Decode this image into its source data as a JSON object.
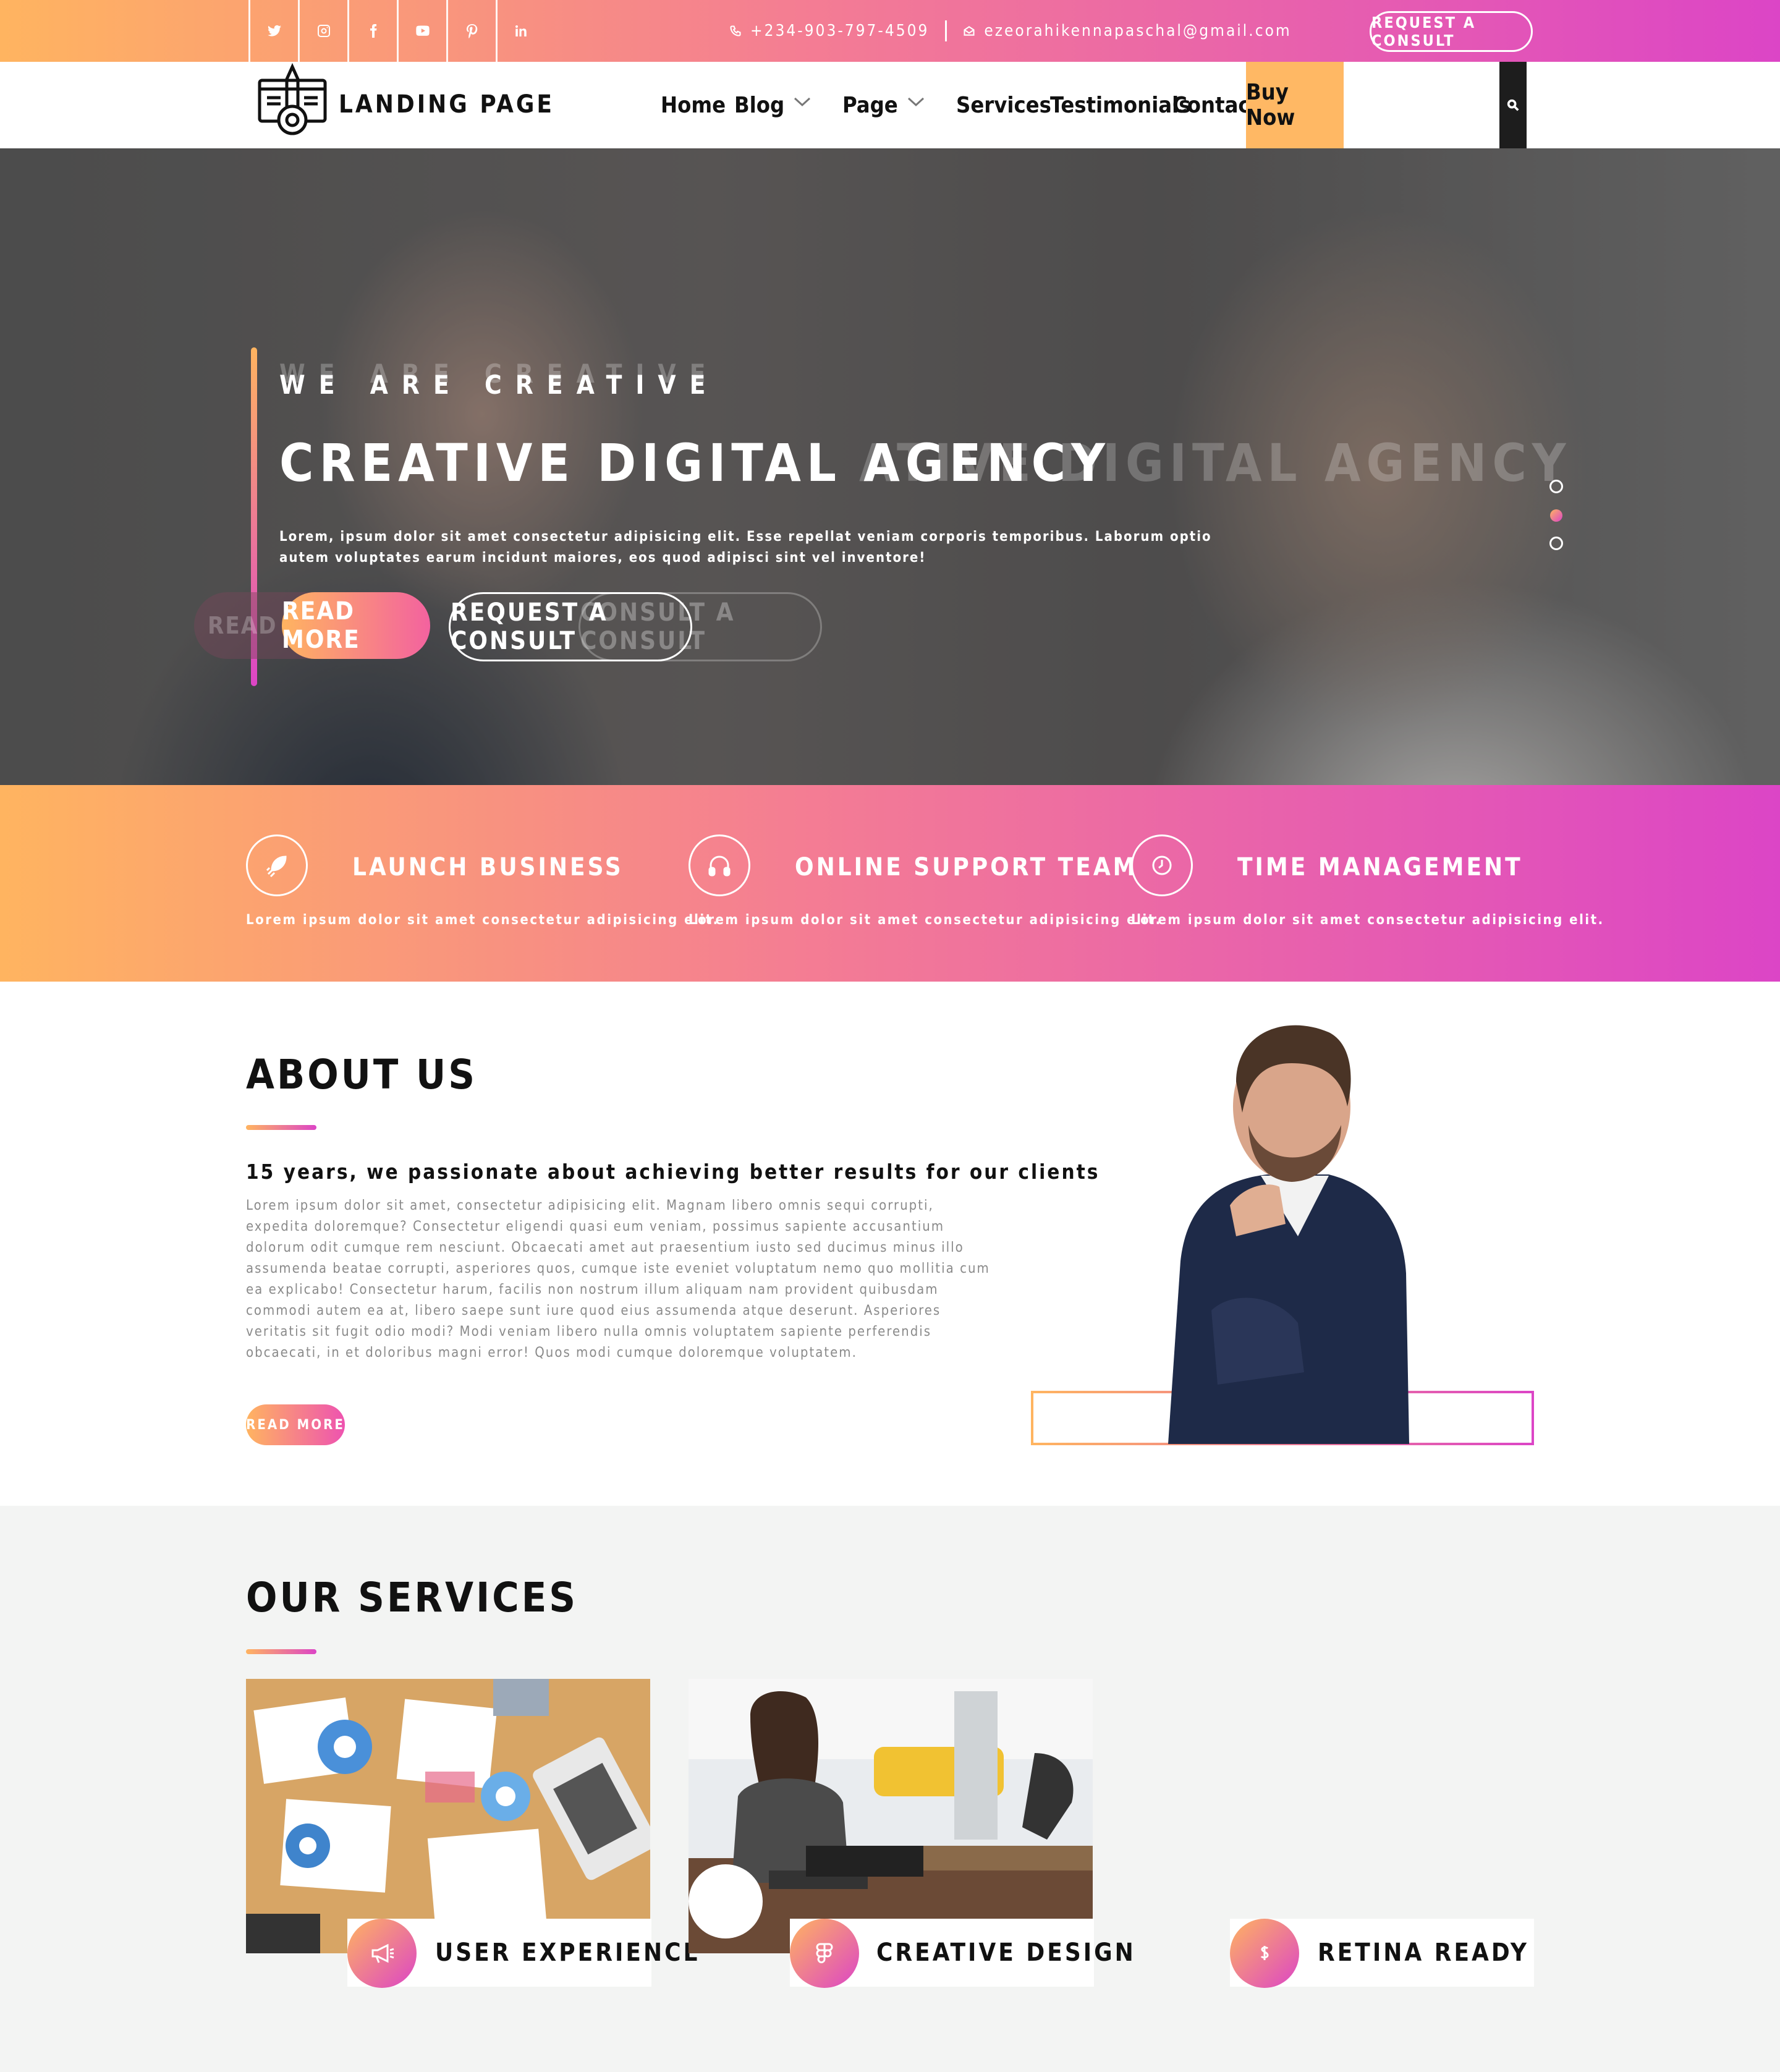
{
  "topbar": {
    "socials": [
      "twitter-icon",
      "instagram-icon",
      "facebook-icon",
      "youtube-icon",
      "pinterest-icon",
      "linkedin-icon"
    ],
    "phone": "+234-903-797-4509",
    "email": "ezeorahikennapaschal@gmail.com",
    "consult_label": "REQUEST A CONSULT"
  },
  "nav": {
    "logo_text": "LANDING PAGE",
    "items": [
      "Home",
      "Blog",
      "Page",
      "Services",
      "Testimonials",
      "Contact"
    ],
    "buy_label": "Buy Now"
  },
  "hero": {
    "subtitle": "WE ARE CREATIVE",
    "title": "CREATIVE DIGITAL AGENCY",
    "title_ghost": "ATIVE DIGITAL AGENCY",
    "text": "Lorem, ipsum dolor sit amet consectetur adipisicing elit. Esse repellat veniam corporis temporibus. Laborum optio autem voluptates earum incidunt maiores, eos quod adipisci sint vel inventore!",
    "read_more": "READ MORE",
    "read_more_ghost": "READ M",
    "consult": "REQUEST A CONSULT",
    "consult_ghost": "CONSULT A CONSULT",
    "slides": 3,
    "active_slide": 2
  },
  "features": [
    {
      "icon": "rocket-icon",
      "title": "LAUNCH BUSINESS",
      "text": "Lorem ipsum dolor sit amet consectetur adipisicing elit."
    },
    {
      "icon": "headphones-icon",
      "title": "ONLINE SUPPORT TEAM",
      "text": "Lorem ipsum dolor sit amet consectetur adipisicing elit."
    },
    {
      "icon": "clock-icon",
      "title": "TIME MANAGEMENT",
      "text": "Lorem ipsum dolor sit amet consectetur adipisicing elit."
    }
  ],
  "about": {
    "title": "ABOUT US",
    "subtitle": "15 years, we passionate about achieving better results for our clients",
    "text": "Lorem ipsum dolor sit amet, consectetur adipisicing elit. Magnam libero omnis sequi corrupti, expedita doloremque? Consectetur eligendi quasi eum veniam, possimus sapiente accusantium dolorum odit cumque rem nesciunt. Obcaecati amet aut praesentium iusto sed ducimus minus illo assumenda beatae corrupti, asperiores quos, cumque iste eveniet voluptatum nemo quo mollitia cum ea explicabo! Consectetur harum, facilis non nostrum illum aliquam nam provident quibusdam commodi autem ea at, libero saepe sunt iure quod eius assumenda atque deserunt. Asperiores veritatis sit fugit odio modi? Modi veniam libero nulla omnis voluptatem sapiente perferendis obcaecati, in et doloribus magni error! Quos modi cumque doloremque voluptatem.",
    "button": "READ MORE"
  },
  "services": {
    "title": "OUR SERVICES",
    "items": [
      {
        "icon": "megaphone-icon",
        "label": "USER EXPERIENCE"
      },
      {
        "icon": "figma-icon",
        "label": "CREATIVE DESIGN"
      },
      {
        "icon": "dollar-icon",
        "label": "RETINA READY"
      }
    ]
  },
  "colors": {
    "gradient_start": "#ffb460",
    "gradient_mid": "#f47d93",
    "gradient_end": "#dc45c6",
    "buy_now_bg": "#ffb864"
  }
}
